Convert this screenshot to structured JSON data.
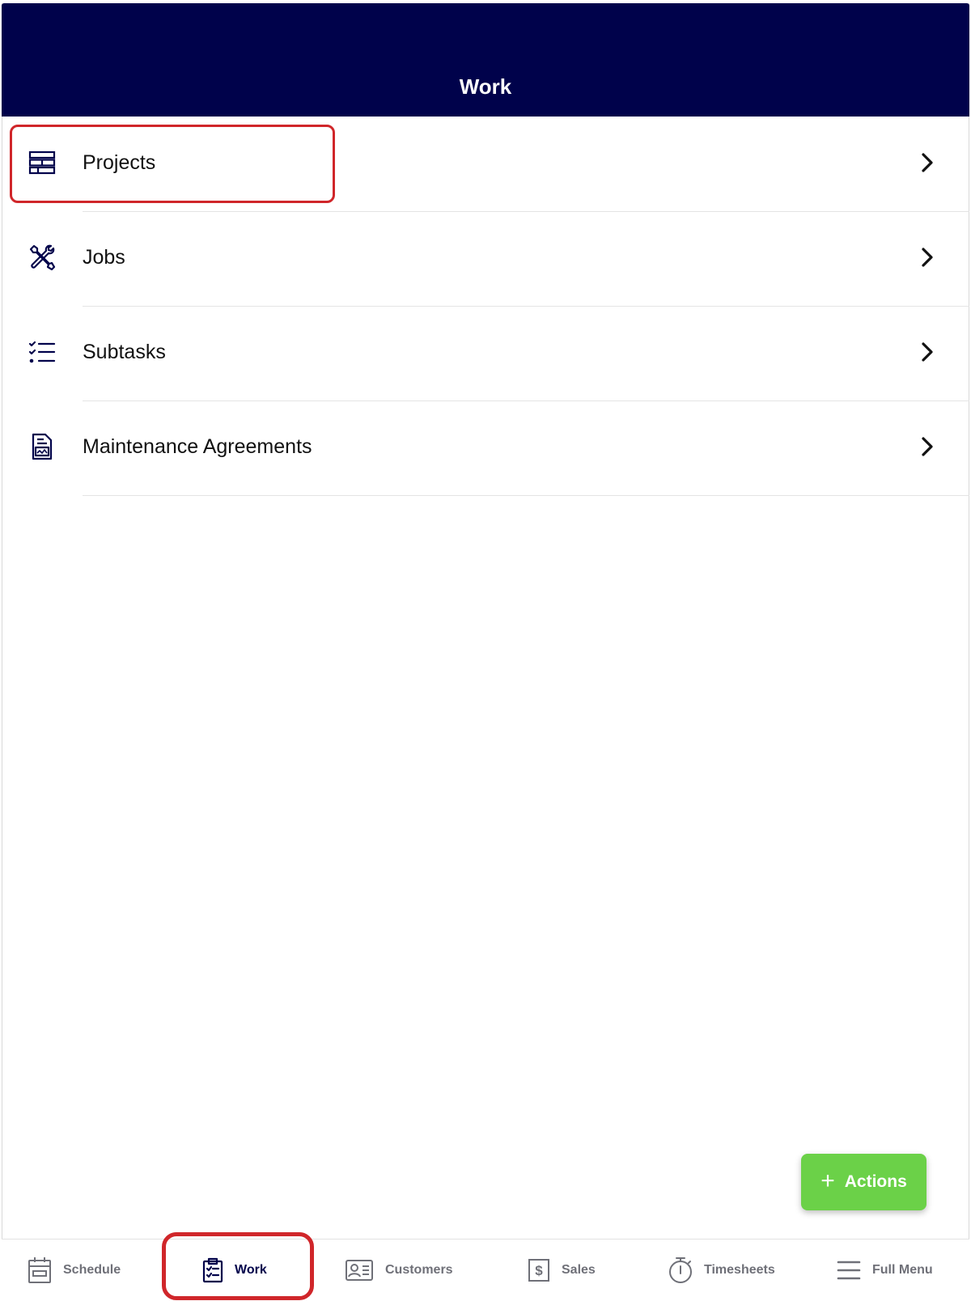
{
  "header": {
    "title": "Work"
  },
  "menu": {
    "items": [
      {
        "label": "Projects",
        "icon": "projects-icon"
      },
      {
        "label": "Jobs",
        "icon": "tools-icon"
      },
      {
        "label": "Subtasks",
        "icon": "checklist-icon"
      },
      {
        "label": "Maintenance Agreements",
        "icon": "agreement-document-icon"
      }
    ]
  },
  "fab": {
    "plus": "+",
    "label": "Actions"
  },
  "tabbar": {
    "tabs": [
      {
        "label": "Schedule",
        "icon": "calendar-icon",
        "active": false
      },
      {
        "label": "Work",
        "icon": "clipboard-icon",
        "active": true
      },
      {
        "label": "Customers",
        "icon": "contact-card-icon",
        "active": false
      },
      {
        "label": "Sales",
        "icon": "dollar-icon",
        "active": false
      },
      {
        "label": "Timesheets",
        "icon": "stopwatch-icon",
        "active": false
      },
      {
        "label": "Full Menu",
        "icon": "hamburger-icon",
        "active": false
      }
    ]
  },
  "colors": {
    "header_bg": "#00024b",
    "accent_green": "#6bd148",
    "highlight_red": "#d0262a",
    "inactive_tab": "#6f7078"
  }
}
